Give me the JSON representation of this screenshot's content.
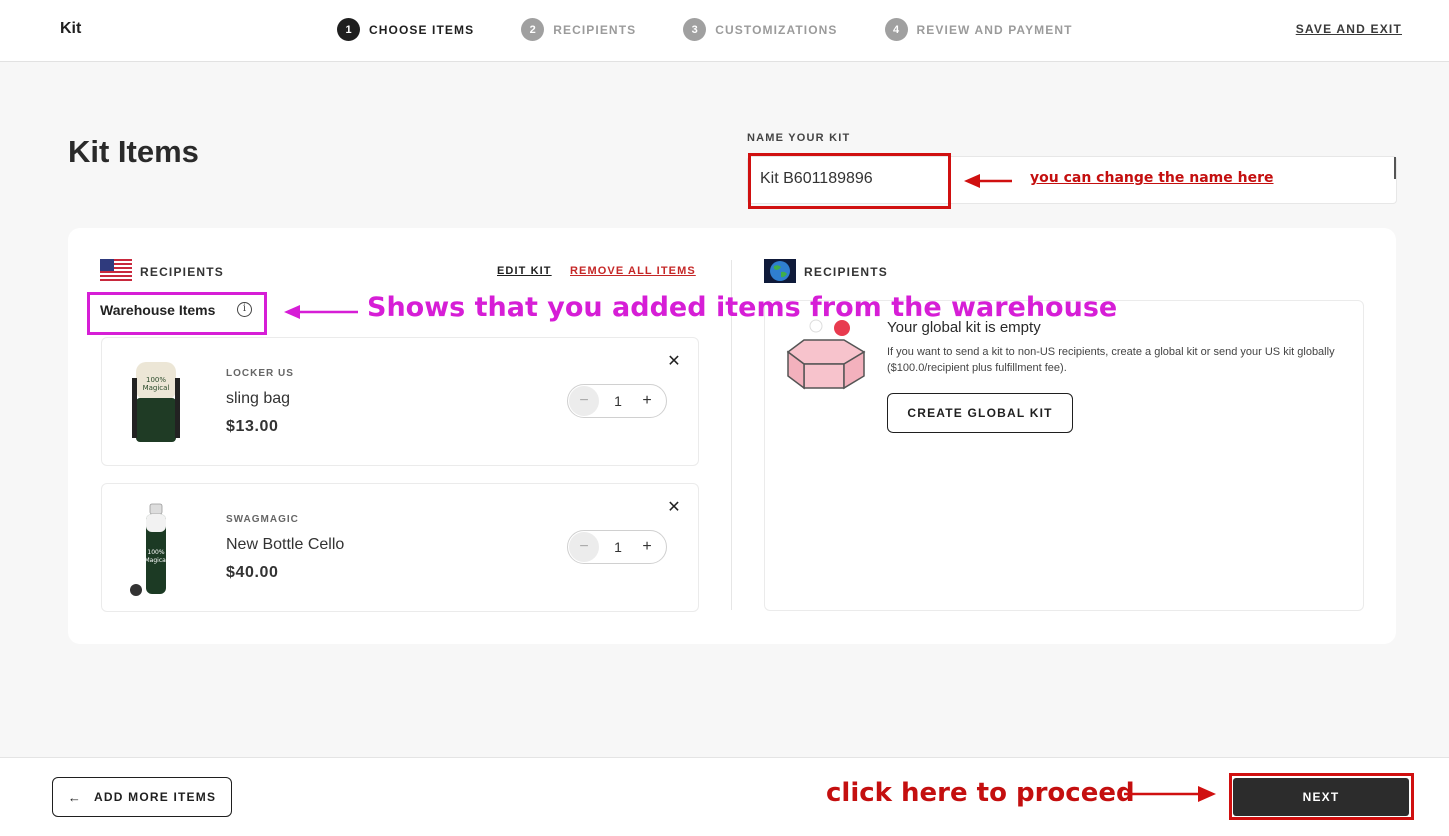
{
  "header": {
    "brand": "Kit",
    "steps": [
      {
        "num": "1",
        "label": "CHOOSE ITEMS",
        "active": true
      },
      {
        "num": "2",
        "label": "RECIPIENTS"
      },
      {
        "num": "3",
        "label": "CUSTOMIZATIONS"
      },
      {
        "num": "4",
        "label": "REVIEW AND PAYMENT"
      }
    ],
    "save_exit": "SAVE AND EXIT"
  },
  "page_title": "Kit Items",
  "kit_name": {
    "label": "NAME YOUR KIT",
    "value": "Kit B601189896"
  },
  "us_section": {
    "recipients_label": "RECIPIENTS",
    "edit_kit": "EDIT KIT",
    "remove_all": "REMOVE ALL ITEMS",
    "warehouse_title": "Warehouse Items",
    "items": [
      {
        "brand": "LOCKER US",
        "name": "sling bag",
        "price": "$13.00",
        "qty": "1"
      },
      {
        "brand": "SWAGMAGIC",
        "name": "New Bottle Cello",
        "price": "$40.00",
        "qty": "1"
      }
    ]
  },
  "global_section": {
    "recipients_label": "RECIPIENTS",
    "empty_title": "Your global kit is empty",
    "empty_desc": "If you want to send a kit to non-US recipients, create a global kit or send your US kit globally ($100.0/recipient plus fulfillment fee).",
    "create_button": "CREATE GLOBAL KIT"
  },
  "footer": {
    "add_more": "ADD MORE ITEMS",
    "next": "NEXT"
  },
  "annotations": {
    "name_hint": "you can change the name here",
    "warehouse_hint": "Shows that you added items from the warehouse",
    "proceed_hint": "click here to proceed"
  },
  "icons": {
    "step": "numbered-circle",
    "info": "info-icon",
    "close": "close-icon",
    "minus": "minus-icon",
    "plus": "plus-icon",
    "back_arrow": "arrow-left-icon",
    "us_flag": "us-flag-icon",
    "globe": "globe-icon"
  },
  "colors": {
    "annotation_red": "#c40f0f",
    "annotation_magenta": "#d61ed6",
    "remove_red": "#c52727",
    "primary_dark": "#2c2c2c"
  }
}
